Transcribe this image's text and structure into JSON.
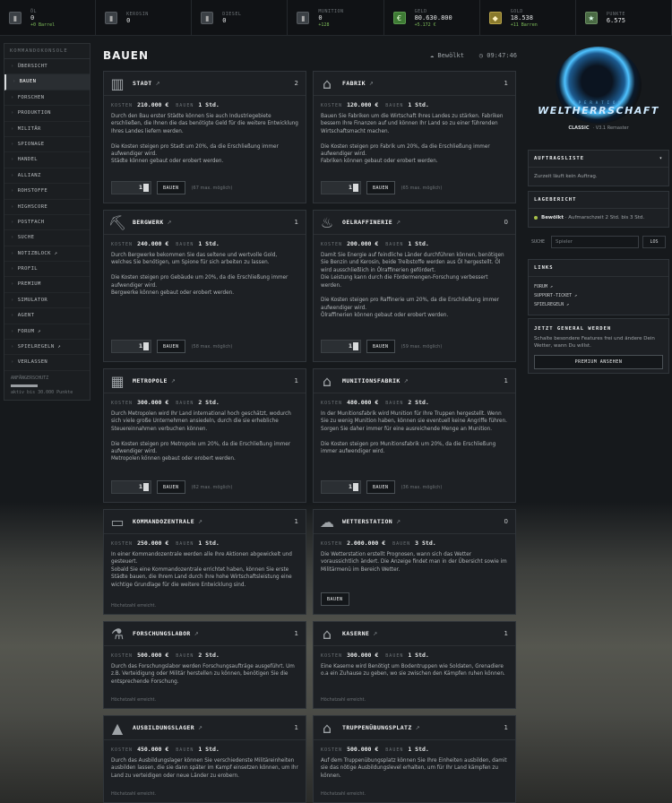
{
  "resources": [
    {
      "label": "ÖL",
      "value": "0",
      "sub": "+0 Barrel",
      "icon": "oil-barrel-icon"
    },
    {
      "label": "KEROSIN",
      "value": "0",
      "sub": "",
      "icon": "kerosene-icon"
    },
    {
      "label": "DIESEL",
      "value": "0",
      "sub": "",
      "icon": "diesel-icon"
    },
    {
      "label": "MUNITION",
      "value": "0",
      "sub": "+128",
      "icon": "ammo-icon"
    },
    {
      "label": "GELD",
      "value": "80.630.800",
      "sub": "+5.172 €",
      "icon": "money-icon"
    },
    {
      "label": "GOLD",
      "value": "18.538",
      "sub": "+11 Barren",
      "icon": "gold-icon"
    },
    {
      "label": "PUNKTE",
      "value": "6.575",
      "sub": "",
      "icon": "points-icon"
    }
  ],
  "sidebar": {
    "header": "KOMMANDOKONSOLE",
    "items": [
      "ÜBERSICHT",
      "BAUEN",
      "FORSCHEN",
      "PRODUKTION",
      "MILITÄR",
      "SPIONAGE",
      "HANDEL",
      "ALLIANZ",
      "ROHSTOFFE",
      "HIGHSCORE",
      "POSTFACH",
      "SUCHE",
      "NOTIZBLOCK ↗",
      "PROFIL",
      "PREMIUM",
      "SIMULATOR",
      "AGENT",
      "FORUM ↗",
      "SPIELREGELN ↗",
      "VERLASSEN"
    ],
    "active": "BAUEN",
    "protection_label": "ANFÄNGERSCHUTZ",
    "protection_progress": 1.0,
    "protection_text": "aktiv bis 30.000 Punkte"
  },
  "page": {
    "title": "BAUEN",
    "weather": "☁ Bewölkt",
    "time": "◷ 09:47:46"
  },
  "labels": {
    "cost": "KOSTEN",
    "duration": "BAUEN",
    "build": "BAUEN",
    "max_reached": "Höchstzahl erreicht."
  },
  "buildings": [
    {
      "name": "STADT",
      "icon": "city-icon",
      "count": "2",
      "cost": "210.000 €",
      "time": "1 Std.",
      "desc": [
        "Durch den Bau erster Städte können Sie auch Industriegebiete erschließen, die Ihnen die das benötigte Geld für die weitere Entwicklung Ihres Landes liefern werden.",
        "",
        "Die Kosten steigen pro Stadt um 20%, da die Erschließung immer aufwendiger wird.",
        "Städte können gebaut oder erobert werden."
      ],
      "qty": "1",
      "max": "(67 max. möglich)"
    },
    {
      "name": "FABRIK",
      "icon": "factory-icon",
      "count": "1",
      "cost": "120.000 €",
      "time": "1 Std.",
      "desc": [
        "Bauen Sie Fabriken um die Wirtschaft Ihres Landes zu stärken. Fabriken bessern Ihre Finanzen auf und können Ihr Land so zu einer führenden Wirtschaftsmacht machen.",
        "",
        "Die Kosten steigen pro Fabrik um 20%, da die Erschließung immer aufwendiger wird.",
        "Fabriken können gebaut oder erobert werden."
      ],
      "qty": "1",
      "max": "(65 max. möglich)"
    },
    {
      "name": "BERGWERK",
      "icon": "mine-icon",
      "count": "1",
      "cost": "240.000 €",
      "time": "1 Std.",
      "desc": [
        "Durch Bergwerke bekommen Sie das seltene und wertvolle Gold, welches Sie benötigen, um Spione für sich arbeiten zu lassen.",
        "",
        "Die Kosten steigen pro Gebäude um 20%, da die Erschließung immer aufwendiger wird.",
        "Bergwerke können gebaut oder erobert werden."
      ],
      "qty": "1",
      "max": "(58 max. möglich)"
    },
    {
      "name": "OELRAFFINERIE",
      "icon": "refinery-icon",
      "count": "0",
      "cost": "200.000 €",
      "time": "1 Std.",
      "desc": [
        "Damit Sie Energie auf feindliche Länder durchführen können, benötigen Sie Benzin und Kerosin, beide Treibstoffe werden aus Öl hergestellt. Öl wird ausschließlich in Ölraffinerien gefördert.",
        "Die Leistung kann durch die Fördermengen-Forschung verbessert werden.",
        "",
        "Die Kosten steigen pro Raffinerie um 20%, da die Erschließung immer aufwendiger wird.",
        "Ölraffinerien können gebaut oder erobert werden."
      ],
      "qty": "1",
      "max": "(59 max. möglich)"
    },
    {
      "name": "METROPOLE",
      "icon": "metropolis-icon",
      "count": "1",
      "cost": "300.000 €",
      "time": "2 Std.",
      "desc": [
        "Durch Metropolen wird Ihr Land international hoch geschätzt, wodurch sich viele große Unternehmen ansiedeln, durch die sie erhebliche Steuereinnahmen verbuchen können.",
        "",
        "Die Kosten steigen pro Metropole um 20%, da die Erschließung immer aufwendiger wird.",
        "Metropolen können gebaut oder erobert werden."
      ],
      "qty": "1",
      "max": "(62 max. möglich)"
    },
    {
      "name": "MUNITIONSFABRIK",
      "icon": "ammo-factory-icon",
      "count": "1",
      "cost": "480.000 €",
      "time": "2 Std.",
      "desc": [
        "In der Munitionsfabrik wird Munition für Ihre Truppen hergestellt. Wenn Sie zu wenig Munition haben, können sie eventuell keine Angriffe führen. Sorgen Sie daher immer für eine ausreichende Menge an Munition.",
        "",
        "Die Kosten steigen pro Munitionsfabrik um 20%, da die Erschließung immer aufwendiger wird."
      ],
      "qty": "1",
      "max": "(36 max. möglich)"
    },
    {
      "name": "KOMMANDOZENTRALE",
      "icon": "command-center-icon",
      "count": "1",
      "cost": "250.000 €",
      "time": "1 Std.",
      "desc": [
        "In einer Kommandozentrale werden alle Ihre Aktionen abgewickelt und gesteuert.",
        "Sobald Sie eine Kommandozentrale errichtet haben, können Sie erste Städte bauen, die Ihrem Land durch ihre hohe Wirtschaftsleistung eine wichtige Grundlage für die weitere Entwicklung sind."
      ],
      "max_reached": true
    },
    {
      "name": "WETTERSTATION",
      "icon": "weather-station-icon",
      "count": "0",
      "cost": "2.000.000 €",
      "time": "3 Std.",
      "desc": [
        "Die Wetterstation erstellt Prognosen, wann sich das Wetter voraussichtlich ändert. Die Anzeige findet man in der Übersicht sowie im Militärmenü im Bereich Wetter."
      ],
      "build_only": true
    },
    {
      "name": "FORSCHUNGSLABOR",
      "icon": "lab-icon",
      "count": "1",
      "cost": "500.000 €",
      "time": "2 Std.",
      "desc": [
        "Durch das Forschungslabor werden Forschungsaufträge ausgeführt. Um z.B. Verteidigung oder Militär herstellen zu können, benötigen Sie die entsprechende Forschung."
      ],
      "max_reached": true
    },
    {
      "name": "KASERNE",
      "icon": "barracks-icon",
      "count": "1",
      "cost": "300.000 €",
      "time": "1 Std.",
      "desc": [
        "Eine Kaserne wird Benötigt um Bodentruppen wie Soldaten, Grenadiere o.a ein Zuhause zu geben, wo sie zwischen den Kämpfen ruhen können."
      ],
      "max_reached": true
    },
    {
      "name": "AUSBILDUNGSLAGER",
      "icon": "training-camp-icon",
      "count": "1",
      "cost": "450.000 €",
      "time": "1 Std.",
      "desc": [
        "Durch das Ausbildungslager können Sie verschiedenste Militäreinheiten ausbilden lassen, die sie dann später im Kampf einsetzen können, um Ihr Land zu verteidigen oder neue Länder zu erobern."
      ],
      "max_reached": true
    },
    {
      "name": "TRUPPENÜBUNGSPLATZ",
      "icon": "training-ground-icon",
      "count": "1",
      "cost": "500.000 €",
      "time": "1 Std.",
      "desc": [
        "Auf dem Truppenübungsplatz können Sie Ihre Einheiten ausbilden, damit sie das nötige Ausbildungslevel erhalten, um für Ihr Land kämpfen zu können."
      ],
      "max_reached": true
    }
  ],
  "logo": {
    "line1": "OPERATION",
    "line2": "WELTHERRSCHAFT",
    "edition": "CLASSIC",
    "version": "· V3.1 Remaster"
  },
  "queue": {
    "title": "AUFTRAGSLISTE",
    "toggle": "▾",
    "text": "Zurzeit läuft kein Auftrag."
  },
  "situation": {
    "title": "LAGEBERICHT",
    "status": "Bewölkt",
    "text": "· Aufmarschzeit 2 Std. bis 3 Std."
  },
  "search": {
    "label": "SUCHE",
    "placeholder": "Spieler",
    "button": "LOS"
  },
  "links": {
    "title": "LINKS",
    "items": [
      "FORUM ↗",
      "SUPPORT-TICKET ↗",
      "SPIELREGELN ↗"
    ]
  },
  "premium": {
    "title": "JETZT GENERAL WERDEN",
    "text": "Schalte besondere Features frei und ändere Dein Wetter, wann Du willst.",
    "button": "PREMIUM ANSEHEN"
  }
}
